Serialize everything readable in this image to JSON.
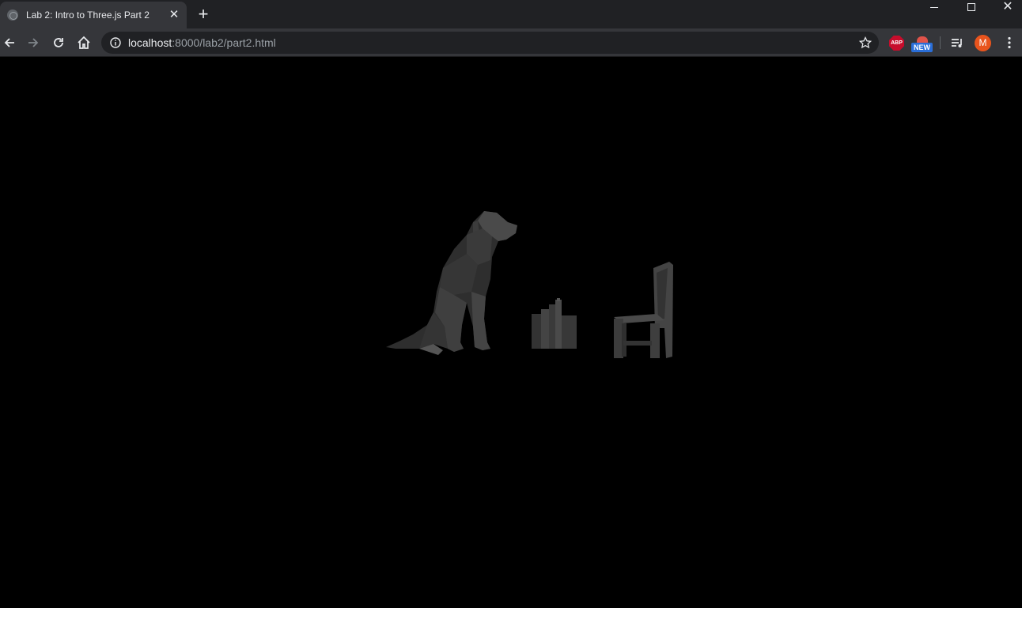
{
  "window": {
    "tab_title": "Lab 2: Intro to Three.js Part 2",
    "tab_close": "✕",
    "new_tab": "+",
    "close_glyph": "✕"
  },
  "toolbar": {
    "url_host": "localhost",
    "url_rest": ":8000/lab2/part2.html",
    "extensions": {
      "abp_label": "ABP",
      "new_badge": "NEW"
    },
    "profile_initial": "M"
  },
  "scene": {
    "objects": [
      "dog-model",
      "books-model",
      "chair-model"
    ],
    "background_color": "#000000",
    "model_color": "#3a3a3a"
  }
}
